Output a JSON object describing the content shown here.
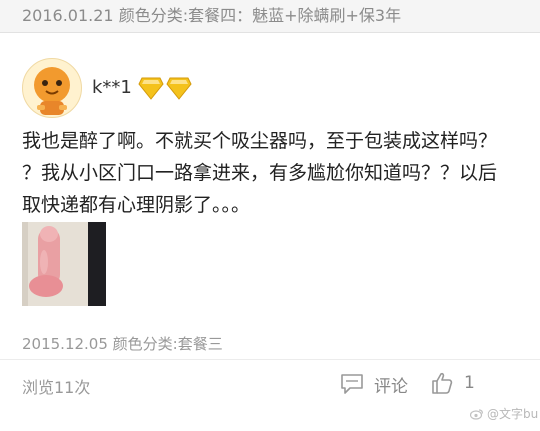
{
  "order_header": {
    "meta_text": "2016.01.21 颜色分类:套餐四：魅蓝+除螨刷+保3年"
  },
  "review": {
    "username": "k**1",
    "badge_icon": "diamond-icon",
    "badge_color": "#f4c21c",
    "badge_count": 2,
    "comment_lines": [
      "我也是醉了啊。不就买个吸尘器吗，至于包装成这样吗？",
      "？我从小区门口一路拿进来，有多尴尬你知道吗？？以后",
      "取快递都有心理阴影了。。。"
    ],
    "meta_text": "2015.12.05 颜色分类:套餐三"
  },
  "footer": {
    "views_text": "浏览11次",
    "comment_label": "评论",
    "like_count": "1"
  },
  "watermark": {
    "text": "@文字bu"
  }
}
